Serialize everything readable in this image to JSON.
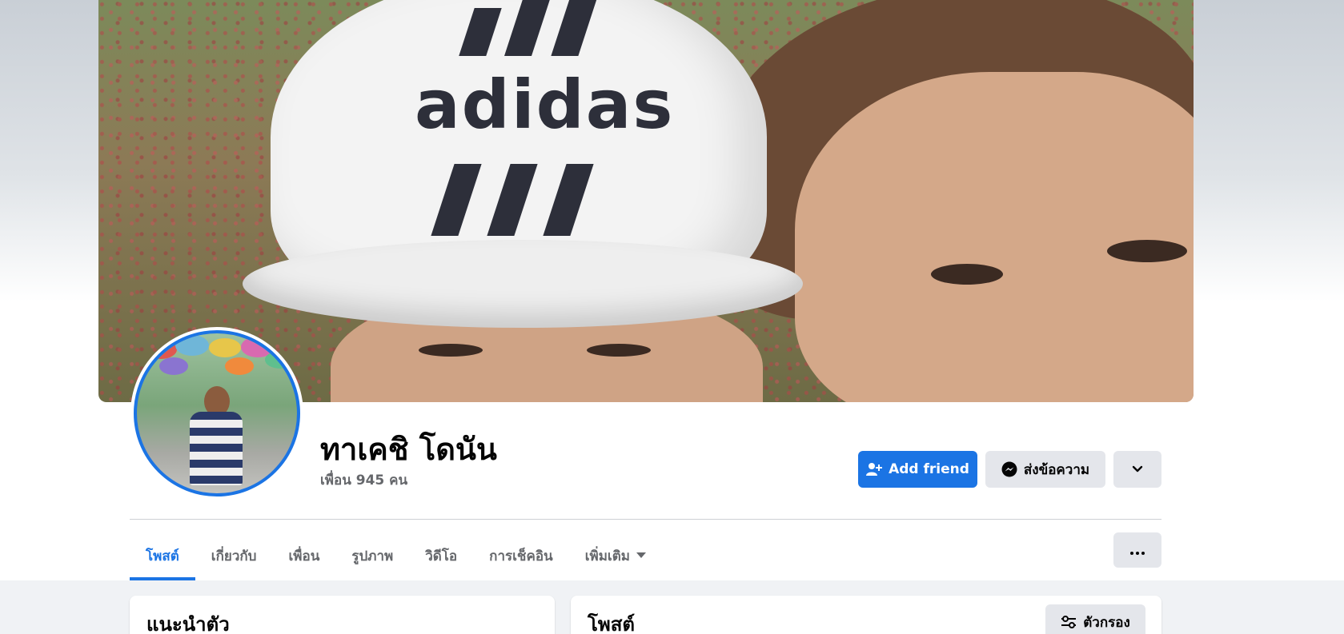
{
  "profile": {
    "name": "ทาเคชิ โดนัน",
    "friends_count": "เพื่อน 945 คน"
  },
  "cover": {
    "cap_text": "adidas"
  },
  "actions": {
    "add_friend": "Add friend",
    "message": "ส่งข้อความ"
  },
  "tabs": [
    {
      "label": "โพสต์",
      "active": true
    },
    {
      "label": "เกี่ยวกับ"
    },
    {
      "label": "เพื่อน"
    },
    {
      "label": "รูปภาพ"
    },
    {
      "label": "วิดีโอ"
    },
    {
      "label": "การเช็คอิน"
    },
    {
      "label": "เพิ่มเติม"
    }
  ],
  "intro_card": {
    "title": "แนะนำตัว"
  },
  "posts_card": {
    "title": "โพสต์",
    "filter_label": "ตัวกรอง"
  },
  "icons": {
    "add_friend": "person-add-icon",
    "message": "messenger-icon",
    "dropdown": "chevron-down-icon",
    "more": "ellipsis-icon",
    "filter": "sliders-icon",
    "tab_caret": "caret-down-icon"
  },
  "colors": {
    "accent": "#1b74e4",
    "secondary_button": "#e4e6eb",
    "muted_text": "#65676b"
  }
}
